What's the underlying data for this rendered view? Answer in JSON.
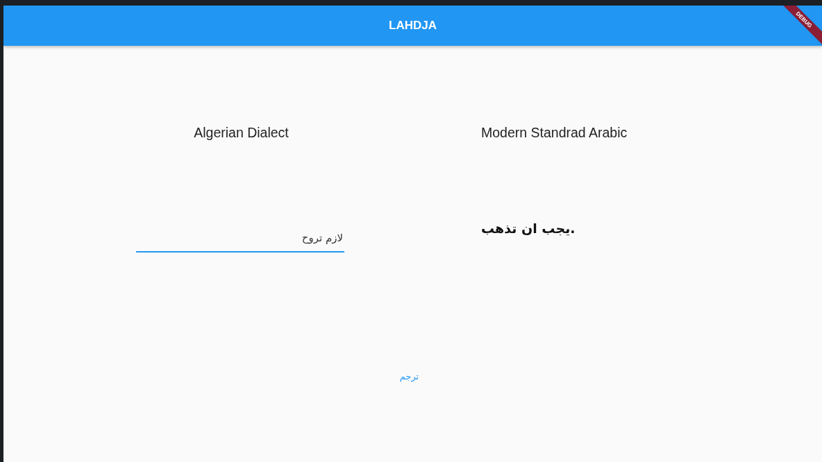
{
  "app_bar": {
    "title": "LAHDJA"
  },
  "debug_banner": {
    "label": "DEBUG"
  },
  "source_panel": {
    "heading": "Algerian Dialect",
    "value": "لازم تروح"
  },
  "target_panel": {
    "heading": "Modern Standrad Arabic",
    "value": "يجب ان تذهب."
  },
  "translate_button": {
    "label": "ترجم"
  }
}
